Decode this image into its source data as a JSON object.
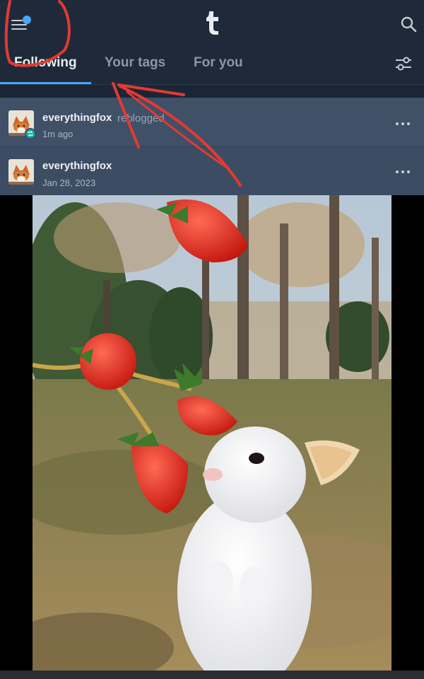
{
  "header": {
    "logo_icon": "tumblr-t-logo-icon",
    "menu_icon": "hamburger-menu-icon",
    "notification_dot_color": "#4ba6f5",
    "search_icon": "search-icon"
  },
  "tabs": [
    {
      "label": "Following",
      "active": true
    },
    {
      "label": "Your tags",
      "active": false
    },
    {
      "label": "For you",
      "active": false
    }
  ],
  "filter_icon": "sliders-filter-icon",
  "reblog_header": {
    "username": "everythingfox",
    "action": "reblogged",
    "time": "1m ago"
  },
  "post_header": {
    "username": "everythingfox",
    "date": "Jan 28, 2023"
  },
  "post_image": {
    "subject": "white bunny reaching for strawberries on a branch outdoors"
  },
  "annotation": {
    "color": "#e23a32"
  }
}
